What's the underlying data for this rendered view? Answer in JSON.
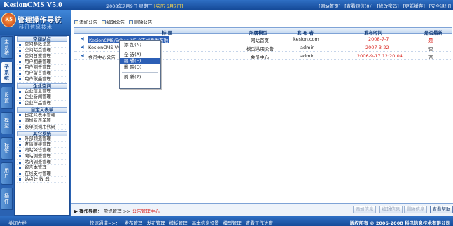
{
  "header": {
    "title": "KesionCMS V5.0",
    "date": "2008年7月9日 星期三",
    "lunar": "[农历 6月7日]",
    "links": [
      "[网站首页]",
      "[查看短信(0)]",
      "[修改密码]",
      "[更新缓存]",
      "[安全退出]"
    ]
  },
  "sidebar": {
    "badge": "KS",
    "title": "管理操作导航",
    "subtitle": "科汛信息技术",
    "tabs": [
      "主系统",
      "子系统",
      "设置",
      "模型",
      "标签",
      "用户",
      "插件"
    ],
    "sections": [
      {
        "title": "空间站点",
        "items": [
          "空间参数设置",
          "空间站点管理",
          "空间日志管理",
          "用户相册管理",
          "用户圈子管理",
          "用户留言管理",
          "用户歌曲管理"
        ]
      },
      {
        "title": "企业空间",
        "items": [
          "企业信息管理",
          "企业新闻管理",
          "企业产品管理"
        ]
      },
      {
        "title": "自定义表单",
        "items": [
          "自定义表单管理",
          "添加新表单项",
          "表单项调用代码"
        ]
      },
      {
        "title": "其它系统",
        "items": [
          "外部频道管理",
          "友情链接管理",
          "网站公告管理",
          "网站调查管理",
          "站内调查管理",
          "留言本管理",
          "在线支付管理",
          "站点计 数 器"
        ]
      }
    ]
  },
  "toolbar": {
    "add": "添加公告",
    "edit": "编辑公告",
    "delete": "删除公告"
  },
  "table": {
    "headers": [
      "标 题",
      "所属模型",
      "发 布 者",
      "发布时间",
      "是否最新"
    ],
    "rows": [
      {
        "title": "KesionCMS/Eshop V5.0正式版发布啦",
        "model": "网站首页",
        "author": "kesion.com",
        "time": "2008-7-7",
        "latest": "是"
      },
      {
        "title": "KesionCMS V4",
        "model": "模型共用公告",
        "author": "admin",
        "time": "2007-3-22",
        "latest": "否"
      },
      {
        "title": "会员中心公告",
        "model": "会员中心",
        "author": "admin",
        "time": "2006-9-17 12:20:04",
        "latest": "否"
      }
    ]
  },
  "context_menu": [
    "添 加(N)",
    "全 选(A)",
    "编 辑(E)",
    "删 除(D)",
    "刷 新(Z)"
  ],
  "bottom": {
    "nav_label": "操作导航：",
    "nav_path": "常规管理 >> ",
    "nav_current": "公告管理中心",
    "buttons": [
      "添加信息",
      "编辑信息",
      "删除信息",
      "查看帮助"
    ]
  },
  "footer": {
    "close": "关闭左栏",
    "quick_label": "快速通道=>：",
    "quick_links": [
      "发布管理",
      "发布管理",
      "模板管理",
      "基本信息设置",
      "模型管理",
      "查看工作进度"
    ],
    "copyright": "版权所有 © 2006-2008  科汛信息技术有限公司"
  },
  "colors": {
    "accent": "#1b4d95",
    "highlight": "#2c5fb6",
    "alert": "#d8221c"
  }
}
